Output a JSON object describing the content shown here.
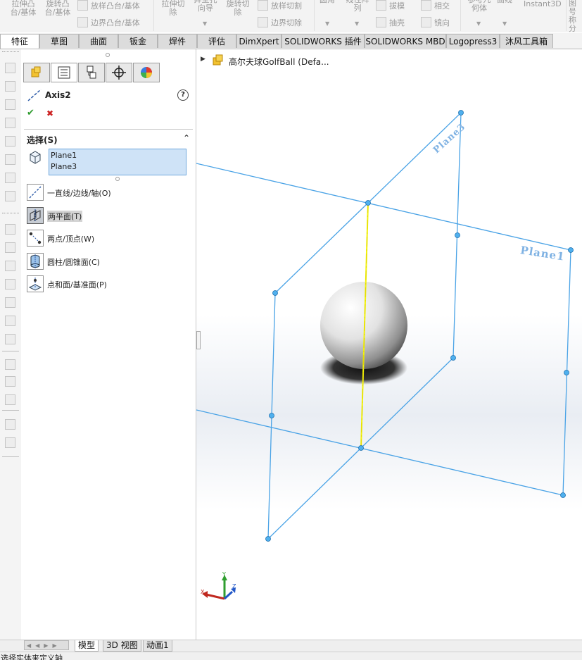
{
  "ribbon": {
    "items": [
      {
        "label": "拉伸凸\n台/基体"
      },
      {
        "label": "旋转凸\n台/基体"
      },
      {
        "label": "放样凸台/基体"
      },
      {
        "label": "边界凸台/基体"
      },
      {
        "label": "拉伸切\n除"
      },
      {
        "label": "异型孔\n向导"
      },
      {
        "label": "旋转切\n除"
      },
      {
        "label": "放样切割"
      },
      {
        "label": "边界切除"
      },
      {
        "label": "圆角"
      },
      {
        "label": "线性阵\n列"
      },
      {
        "label": "拔模"
      },
      {
        "label": "抽壳"
      },
      {
        "label": "相交"
      },
      {
        "label": "镜向"
      },
      {
        "label": "参考几\n何体"
      },
      {
        "label": "曲线"
      },
      {
        "label": "Instant3D"
      },
      {
        "label": "图号\n称分"
      }
    ]
  },
  "tabs": [
    {
      "label": "特征",
      "active": true
    },
    {
      "label": "草图"
    },
    {
      "label": "曲面"
    },
    {
      "label": "钣金"
    },
    {
      "label": "焊件"
    },
    {
      "label": "评估"
    },
    {
      "label": "DimXpert"
    },
    {
      "label": "SOLIDWORKS 插件"
    },
    {
      "label": "SOLIDWORKS MBD"
    },
    {
      "label": "Logopress3"
    },
    {
      "label": "沐风工具箱"
    }
  ],
  "pm": {
    "title": "Axis2",
    "help": "?",
    "ok": "✔",
    "cancel": "✖",
    "section_title": "选择(S)",
    "selections": [
      "Plane1",
      "Plane3"
    ],
    "options": [
      {
        "label": "一直线/边线/轴(O)"
      },
      {
        "label": "两平面(T)",
        "selected": true
      },
      {
        "label": "两点/顶点(W)"
      },
      {
        "label": "圆柱/圆锥面(C)"
      },
      {
        "label": "点和面/基准面(P)"
      }
    ]
  },
  "tree": {
    "item": "高尔夫球GolfBall  (Defa..."
  },
  "viewport": {
    "plane1_label": "Plane1",
    "plane3_label": "Plane3",
    "triad": {
      "x": "X",
      "y": "Y",
      "z": "Z"
    }
  },
  "bottom_tabs": [
    {
      "label": "模型",
      "active": true
    },
    {
      "label": "3D 视图"
    },
    {
      "label": "动画1"
    }
  ],
  "status": "选择实体来定义轴",
  "colors": {
    "plane": "#4aa3e6",
    "axis": "#f2f20a",
    "tab_active": "#ffffff",
    "selection_box": "#cfe3f7"
  }
}
